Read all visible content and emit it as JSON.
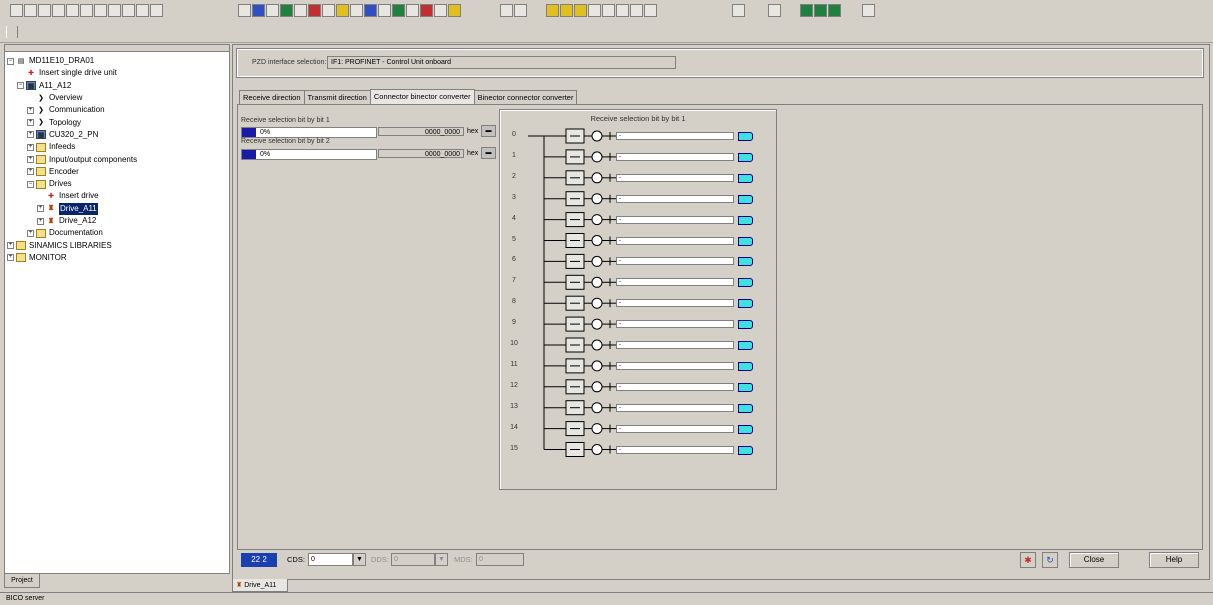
{
  "toolbar": {
    "groups": [
      {
        "icons": [
          "new-icon",
          "open-icon",
          "save-icon",
          "print-preview-icon",
          "print-icon",
          "cut-icon",
          "copy-icon",
          "paste-icon",
          "undo-icon",
          "redo-icon",
          "help-pointer-icon"
        ]
      },
      {
        "icons": [
          "tool-1-icon",
          "tool-2-icon",
          "tool-3-icon",
          "tool-4-icon",
          "tool-5-icon",
          "tool-6-icon",
          "tool-7-icon",
          "tool-8-icon",
          "tool-9-icon",
          "tool-10-icon",
          "tool-11-icon",
          "tool-12-icon",
          "tool-13-icon",
          "tool-14-icon",
          "tool-15-icon",
          "tool-16-icon"
        ]
      },
      {
        "icons": [
          "connect-icon",
          "disconnect-icon"
        ]
      },
      {
        "icons": [
          "download-icon",
          "upload-icon",
          "compare-icon",
          "ram-rom-icon",
          "tool-a-icon",
          "tool-b-icon",
          "tool-c-icon",
          "tool-d-icon"
        ]
      },
      {
        "icons": [
          "trace-icon"
        ]
      },
      {
        "icons": [
          "function-icon"
        ]
      },
      {
        "icons": [
          "window-1-icon",
          "window-2-icon",
          "window-3-icon"
        ]
      },
      {
        "icons": [
          "window-4-icon"
        ]
      }
    ]
  },
  "tree": {
    "items": [
      {
        "label": "MD11E10_DRA01",
        "indent": 0,
        "exp": "−",
        "icon": "project"
      },
      {
        "label": "Insert single drive unit",
        "indent": 1,
        "exp": "",
        "icon": "insert"
      },
      {
        "label": "A11_A12",
        "indent": 1,
        "exp": "−",
        "icon": "dev"
      },
      {
        "label": "Overview",
        "indent": 2,
        "exp": "",
        "icon": "arrow"
      },
      {
        "label": "Communication",
        "indent": 2,
        "exp": "+",
        "icon": "arrow"
      },
      {
        "label": "Topology",
        "indent": 2,
        "exp": "+",
        "icon": "arrow"
      },
      {
        "label": "CU320_2_PN",
        "indent": 2,
        "exp": "+",
        "icon": "dev"
      },
      {
        "label": "Infeeds",
        "indent": 2,
        "exp": "+",
        "icon": "folder"
      },
      {
        "label": "Input/output components",
        "indent": 2,
        "exp": "+",
        "icon": "folder"
      },
      {
        "label": "Encoder",
        "indent": 2,
        "exp": "+",
        "icon": "folder"
      },
      {
        "label": "Drives",
        "indent": 2,
        "exp": "−",
        "icon": "folder"
      },
      {
        "label": "Insert drive",
        "indent": 3,
        "exp": "",
        "icon": "insert"
      },
      {
        "label": "Drive_A11",
        "indent": 3,
        "exp": "+",
        "icon": "drive",
        "selected": true
      },
      {
        "label": "Drive_A12",
        "indent": 3,
        "exp": "+",
        "icon": "drive"
      },
      {
        "label": "Documentation",
        "indent": 2,
        "exp": "+",
        "icon": "folder"
      },
      {
        "label": "SINAMICS LIBRARIES",
        "indent": 0,
        "exp": "+",
        "icon": "folder"
      },
      {
        "label": "MONITOR",
        "indent": 0,
        "exp": "+",
        "icon": "folder"
      }
    ]
  },
  "project_tab": "Project",
  "main": {
    "pzd_label": "PZD interface selection:",
    "pzd_value": "IF1: PROFINET - Control Unit onboard",
    "tabs": [
      {
        "label": "Receive direction",
        "active": false
      },
      {
        "label": "Transmit direction",
        "active": false
      },
      {
        "label": "Connector binector converter",
        "active": true
      },
      {
        "label": "Binector connector converter",
        "active": false
      }
    ],
    "sel1": {
      "label": "Receive selection bit by bit 1",
      "percent": "0%",
      "hex": "0000_0000",
      "hex_unit": "hex"
    },
    "sel2": {
      "label": "Receive selection bit by bit 2",
      "percent": "0%",
      "hex": "0000_0000",
      "hex_unit": "hex"
    },
    "diagram": {
      "title": "Receive selection bit by bit 1",
      "rows": [
        "0",
        "1",
        "2",
        "3",
        "4",
        "5",
        "6",
        "7",
        "8",
        "9",
        "10",
        "11",
        "12",
        "13",
        "14",
        "15"
      ],
      "field_text": "-"
    }
  },
  "bottom": {
    "counter": "22 2",
    "cds_label": "CDS:",
    "cds_value": "0",
    "dds_label": "DDS:",
    "dds_value": "0",
    "mds_label": "MDS:",
    "mds_value": "0",
    "close_label": "Close",
    "help_label": "Help"
  },
  "drive_tab": "Drive_A11",
  "status": "BICO server"
}
